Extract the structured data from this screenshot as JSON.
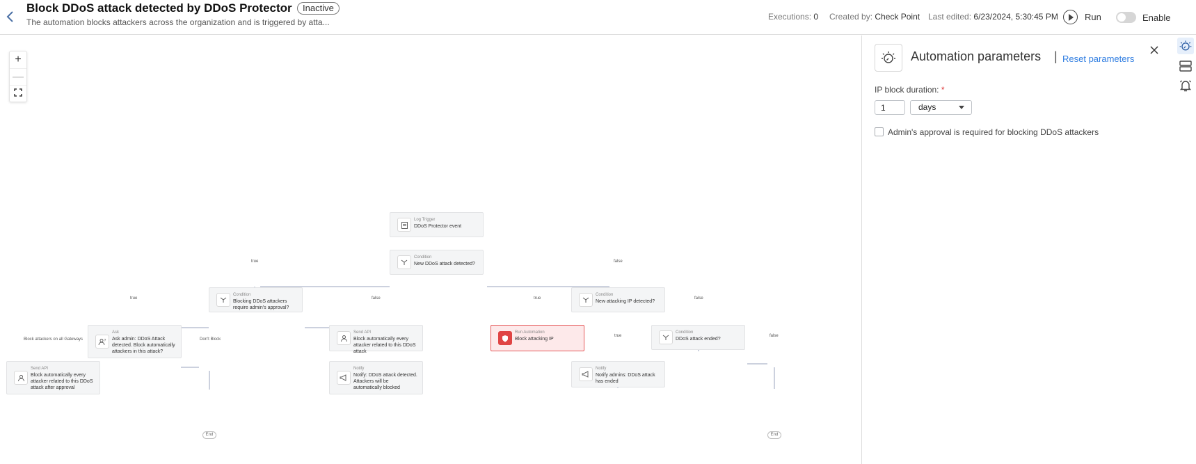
{
  "header": {
    "title": "Block DDoS attack detected by DDoS Protector",
    "status_badge": "Inactive",
    "subtitle": "The automation blocks attackers across the organization and is triggered by atta...",
    "executions_label": "Executions:",
    "executions_value": "0",
    "created_by_label": "Created by:",
    "created_by_value": "Check Point",
    "last_edited_label": "Last edited:",
    "last_edited_value": "6/23/2024, 5:30:45 PM",
    "run_label": "Run",
    "enable_label": "Enable",
    "enabled": false
  },
  "canvas": {
    "zoom_in": "+",
    "zoom_out": "—",
    "nodes": {
      "trigger": {
        "type": "Log Trigger",
        "text": "DDoS Protector event"
      },
      "cond_new_attack": {
        "type": "Condition",
        "text": "New DDoS attack detected?"
      },
      "cond_require_approval": {
        "type": "Condition",
        "text": "Blocking DDoS attackers require admin's approval?"
      },
      "cond_new_ip": {
        "type": "Condition",
        "text": "New attacking IP detected?"
      },
      "ask_admin": {
        "type": "Ask",
        "text": "Ask admin: DDoS Attack detected. Block automatically attackers in this attack?"
      },
      "send_api_every": {
        "type": "Send API",
        "text": "Block automatically every attacker related to this DDoS attack"
      },
      "run_block_ip": {
        "type": "Run Automation",
        "text": "Block attacking IP"
      },
      "cond_attack_ended": {
        "type": "Condition",
        "text": "DDoS attack ended?"
      },
      "send_api_after_approval": {
        "type": "Send API",
        "text": "Block automatically every attacker related to this DDoS attack after approval"
      },
      "notify_blocked": {
        "type": "Notify",
        "text": "Notify: DDoS attack detected. Attackers will be automatically blocked"
      },
      "notify_ended": {
        "type": "Notify",
        "text": "Notify admins: DDoS attack has ended"
      }
    },
    "edge_labels": {
      "true_1": "true",
      "false_1": "false",
      "true_2": "true",
      "false_2": "false",
      "true_3": "true",
      "false_3": "false",
      "block_all": "Block attackers on all Gateways",
      "dont_block": "Don't Block",
      "true_4": "true",
      "false_4": "false"
    },
    "end_label": "End"
  },
  "panel": {
    "title": "Automation parameters",
    "separator": "|",
    "reset_label": "Reset parameters",
    "ip_block_label": "IP block duration:",
    "required_mark": "*",
    "duration_value": "1",
    "duration_unit": "days",
    "approval_label": "Admin's approval is required for blocking DDoS attackers",
    "approval_checked": false
  },
  "colors": {
    "accent": "#2f7de1",
    "edge": "#9aa3bd",
    "node_bg": "#f4f5f6",
    "alert": "#e04444"
  }
}
